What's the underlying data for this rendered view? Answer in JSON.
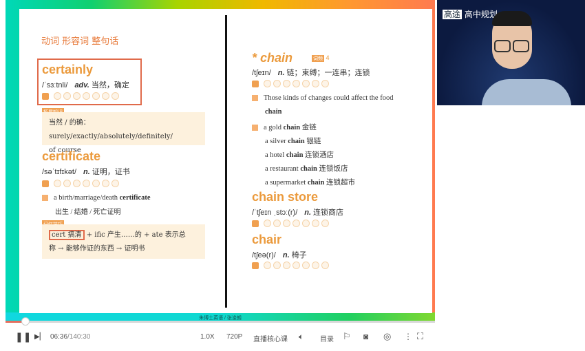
{
  "slide": {
    "heading": "动词 形容词 整句话",
    "left": {
      "certainly": {
        "word": "certainly",
        "phonetic": "/ˈsɜːtnli/",
        "pos": "adv.",
        "meaning": "当然，确定"
      },
      "ext_tag": "拓展知识",
      "ext_text_1": "当然 / 的确：surely/exactly/absolutely/definitely/",
      "ext_text_2": "of course",
      "certificate": {
        "word": "certificate",
        "phonetic": "/səˈtɪfɪkət/",
        "pos": "n.",
        "meaning": "证明，证书"
      },
      "phrase_en": "a birth/marriage/death ",
      "phrase_bold": "certificate",
      "phrase_cn": "出生 / 结婚 / 死亡证明",
      "mem_tag": "记忆技巧",
      "mem_box": "cert 搞清",
      "mem_rest": "+ ific 产生……的 + ate 表示总",
      "mem_line2": "称 → 能够作证的东西 → 证明书"
    },
    "right": {
      "chain": {
        "star": "*",
        "word": "chain",
        "freq_tag": "词频",
        "freq": "4",
        "phonetic": "/tʃeɪn/",
        "pos": "n.",
        "meaning": "链；束缚；一连串；连锁"
      },
      "example": "Those kinds of changes could affect the food",
      "example_bold": "chain",
      "phrases": [
        {
          "pre": "a gold ",
          "b": "chain",
          "cn": " 金链"
        },
        {
          "pre": "a silver ",
          "b": "chain",
          "cn": " 银链"
        },
        {
          "pre": "a hotel ",
          "b": "chain",
          "cn": " 连锁酒店"
        },
        {
          "pre": "a restaurant ",
          "b": "chain",
          "cn": " 连锁饭店"
        },
        {
          "pre": "a supermarket ",
          "b": "chain",
          "cn": " 连锁超市"
        }
      ],
      "chain_store": {
        "word": "chain store",
        "phonetic": "/ˈtʃeɪn ˌstɔː(r)/",
        "pos": "n.",
        "meaning": "连锁商店"
      },
      "chair": {
        "word": "chair",
        "phonetic": "/tʃeə(r)/",
        "pos": "n.",
        "meaning": "椅子"
      }
    },
    "caption": "朱博士英语 / 张浚朗"
  },
  "camera": {
    "logo": "高途",
    "title": "高中规划"
  },
  "player": {
    "time_current": "06:36",
    "time_total": "/140:30",
    "progress": 0.047,
    "speed": "1.0X",
    "quality": "720P",
    "course": "直播核心课",
    "toc": "目录"
  },
  "colors": {
    "accent": "#eb9a3c",
    "progress": "#e27060"
  }
}
